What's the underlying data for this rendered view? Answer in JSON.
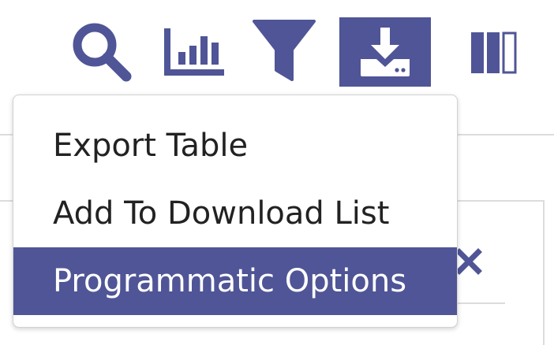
{
  "toolbar": {
    "buttons": [
      {
        "icon": "search-icon",
        "active": false
      },
      {
        "icon": "bar-chart-icon",
        "active": false
      },
      {
        "icon": "filter-icon",
        "active": false
      },
      {
        "icon": "download-icon",
        "active": true
      },
      {
        "icon": "columns-icon",
        "active": false
      }
    ]
  },
  "menu": {
    "items": [
      {
        "label": "Export Table"
      },
      {
        "label": "Add To Download List"
      },
      {
        "label": "Programmatic Options"
      }
    ],
    "selected_index": 2
  },
  "colors": {
    "accent": "#4f5596",
    "text": "#222222",
    "menu_border": "#d2d2d2"
  }
}
